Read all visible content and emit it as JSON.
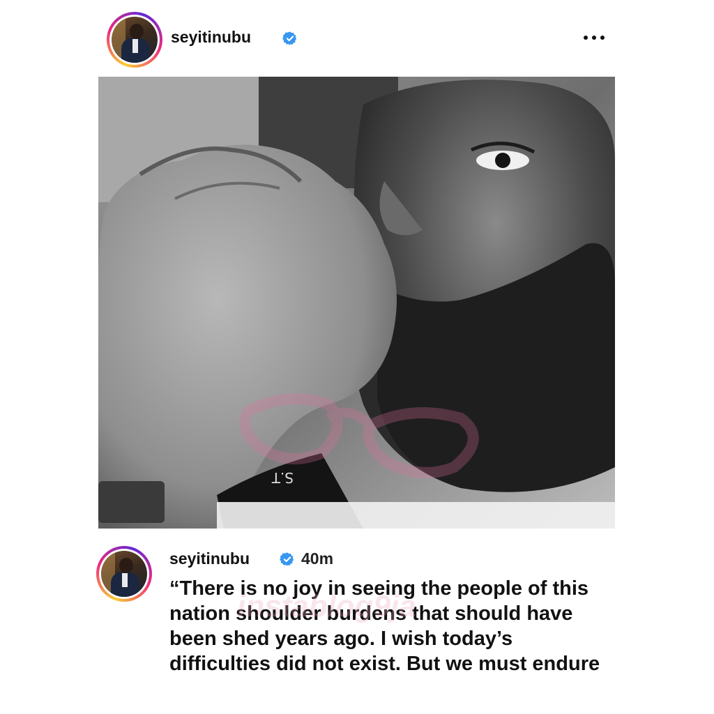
{
  "header": {
    "username": "seyitinubu",
    "verified": true,
    "more_icon": "more-horizontal-icon"
  },
  "post": {
    "image_description_icon": "photo",
    "watermark_text": "instablog9ja",
    "watermark_wrist_text": "S.T"
  },
  "caption": {
    "username": "seyitinubu",
    "verified": true,
    "time": "40m",
    "text": "“There is no joy in seeing the people of this\nnation shoulder burdens that should have\nbeen shed years ago. I wish today’s\ndifficulties did not exist. But we must endure"
  },
  "colors": {
    "verified_blue": "#3897f0",
    "story_ring_start": "#f9ce34",
    "story_ring_mid": "#ee2a7b",
    "story_ring_end": "#6228d7"
  }
}
